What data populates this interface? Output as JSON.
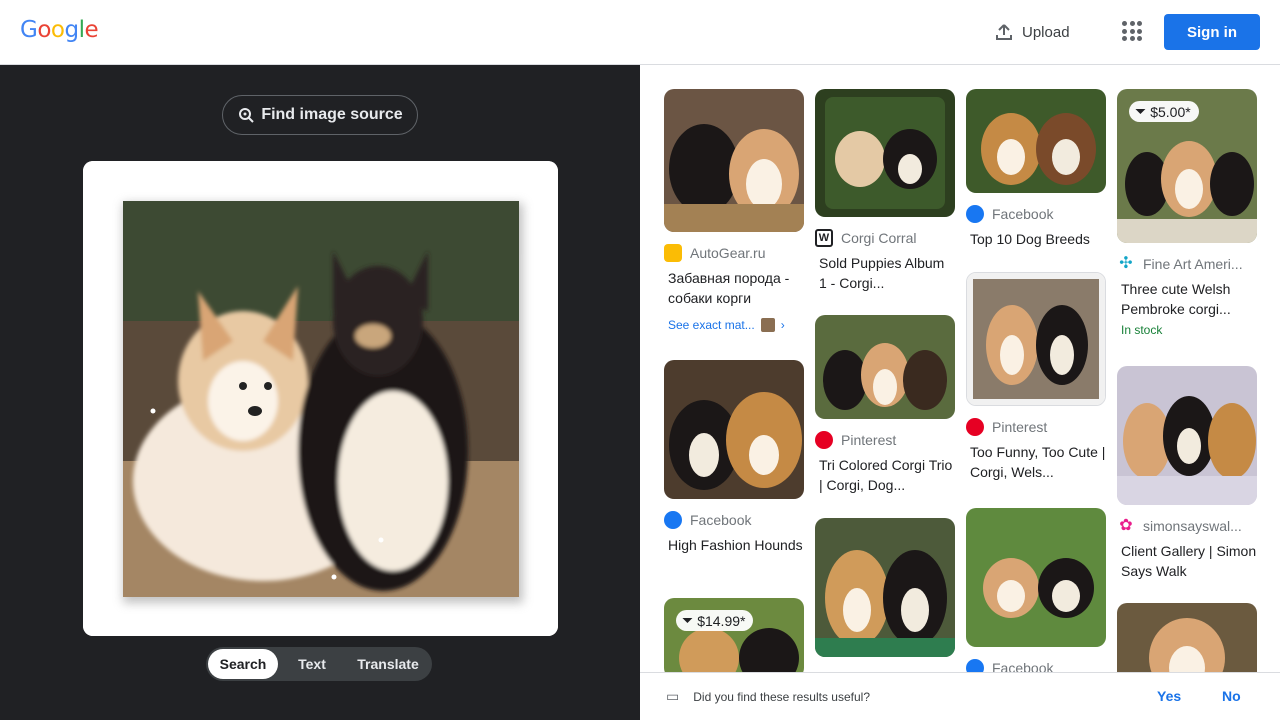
{
  "header": {
    "logo": [
      "G",
      "o",
      "o",
      "g",
      "l",
      "e"
    ],
    "logo_colors": [
      "#4285f4",
      "#ea4335",
      "#fbbc05",
      "#4285f4",
      "#34a853",
      "#ea4335"
    ],
    "upload_label": "Upload",
    "signin_label": "Sign in"
  },
  "left": {
    "find_source_label": "Find image source",
    "modes": [
      "Search",
      "Text",
      "Translate"
    ],
    "active_mode": "Search"
  },
  "results": [
    {
      "source": "AutoGear.ru",
      "title": "Забавная порода - собаки корги",
      "see_exact": "See exact mat...",
      "icon": "autogear-icon"
    },
    {
      "source": "Corgi Corral",
      "title": "Sold Puppies Album 1 - Corgi...",
      "icon": "corgi-corral-icon"
    },
    {
      "source": "Facebook",
      "title": "Top 10 Dog Breeds",
      "icon": "facebook-icon"
    },
    {
      "source": "Fine Art Ameri...",
      "title": "Three cute Welsh Pembroke corgi...",
      "price": "$5.00*",
      "stock": "In stock",
      "icon": "fine-art-icon"
    },
    {
      "source": "Facebook",
      "title": "High Fashion Hounds",
      "icon": "facebook-icon"
    },
    {
      "source": "Pinterest",
      "title": "Tri Colored Corgi Trio | Corgi, Dog...",
      "icon": "pinterest-icon"
    },
    {
      "source": "Pinterest",
      "title": "Too Funny, Too Cute | Corgi, Wels...",
      "icon": "pinterest-icon"
    },
    {
      "source": "simonsayswal...",
      "title": "Client Gallery | Simon Says Walk",
      "icon": "simon-says-icon"
    },
    {
      "price": "$14.99*"
    },
    {
      "source": "Facebook"
    }
  ],
  "feedback": {
    "question": "Did you find these results useful?",
    "yes": "Yes",
    "no": "No"
  }
}
